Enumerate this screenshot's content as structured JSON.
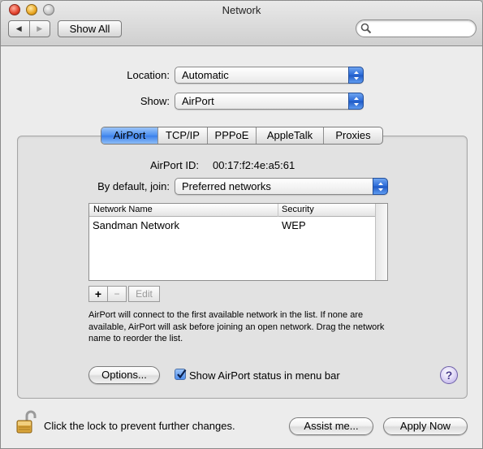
{
  "window": {
    "title": "Network"
  },
  "toolbar": {
    "back_icon": "back-arrow-icon",
    "forward_icon": "forward-arrow-icon",
    "show_all_label": "Show All",
    "search_placeholder": "",
    "search_value": ""
  },
  "location": {
    "label": "Location:",
    "value": "Automatic"
  },
  "show": {
    "label": "Show:",
    "value": "AirPort"
  },
  "tabs": [
    {
      "label": "AirPort",
      "active": true
    },
    {
      "label": "TCP/IP",
      "active": false
    },
    {
      "label": "PPPoE",
      "active": false
    },
    {
      "label": "AppleTalk",
      "active": false
    },
    {
      "label": "Proxies",
      "active": false
    }
  ],
  "airport": {
    "id_label": "AirPort ID:",
    "id_value": "00:17:f2:4e:a5:61",
    "join_label": "By default, join:",
    "join_value": "Preferred networks",
    "table": {
      "columns": [
        "Network Name",
        "Security"
      ],
      "rows": [
        {
          "name": "Sandman Network",
          "security": "WEP"
        }
      ]
    },
    "add_label": "+",
    "remove_label": "−",
    "edit_label": "Edit",
    "description": "AirPort will connect to the first available network in the list. If none are available, AirPort will ask before joining an open network. Drag the network name to reorder the list.",
    "options_label": "Options...",
    "show_status_label": "Show AirPort status in menu bar",
    "show_status_checked": true,
    "help_label": "?"
  },
  "footer": {
    "lock_text": "Click the lock to prevent further changes.",
    "assist_label": "Assist me...",
    "apply_label": "Apply Now"
  },
  "colors": {
    "accent_blue": "#3a7fea",
    "window_bg": "#ececec"
  }
}
